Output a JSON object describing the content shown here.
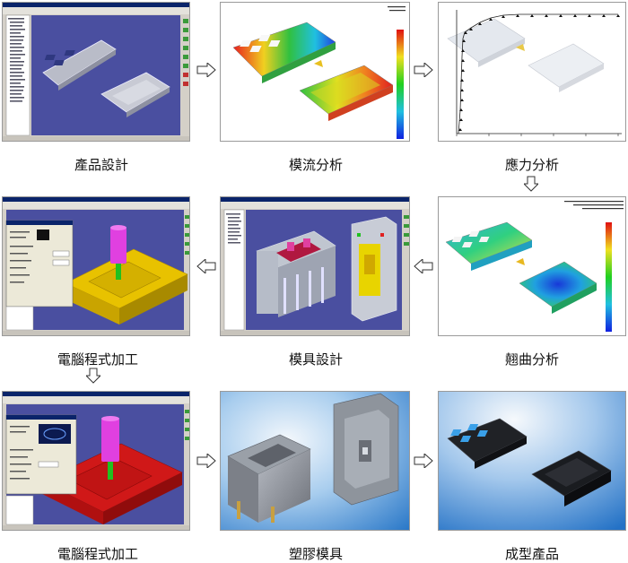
{
  "steps": [
    {
      "label": "產品設計"
    },
    {
      "label": "模流分析"
    },
    {
      "label": "應力分析"
    },
    {
      "label": "翹曲分析"
    },
    {
      "label": "模具設計"
    },
    {
      "label": "電腦程式加工"
    },
    {
      "label": "電腦程式加工"
    },
    {
      "label": "塑膠模具"
    },
    {
      "label": "成型產品"
    }
  ],
  "colors": {
    "cad_viewport": "#4a4fa0",
    "window_chrome": "#d4d0c8",
    "titlebar": "#0a246a",
    "machining_part_yellow": "#e8c200",
    "machining_part_red": "#d01818",
    "tool_magenta": "#e040e0",
    "mold_background": "#3a86d0",
    "product_background": "#2c7ad0"
  }
}
